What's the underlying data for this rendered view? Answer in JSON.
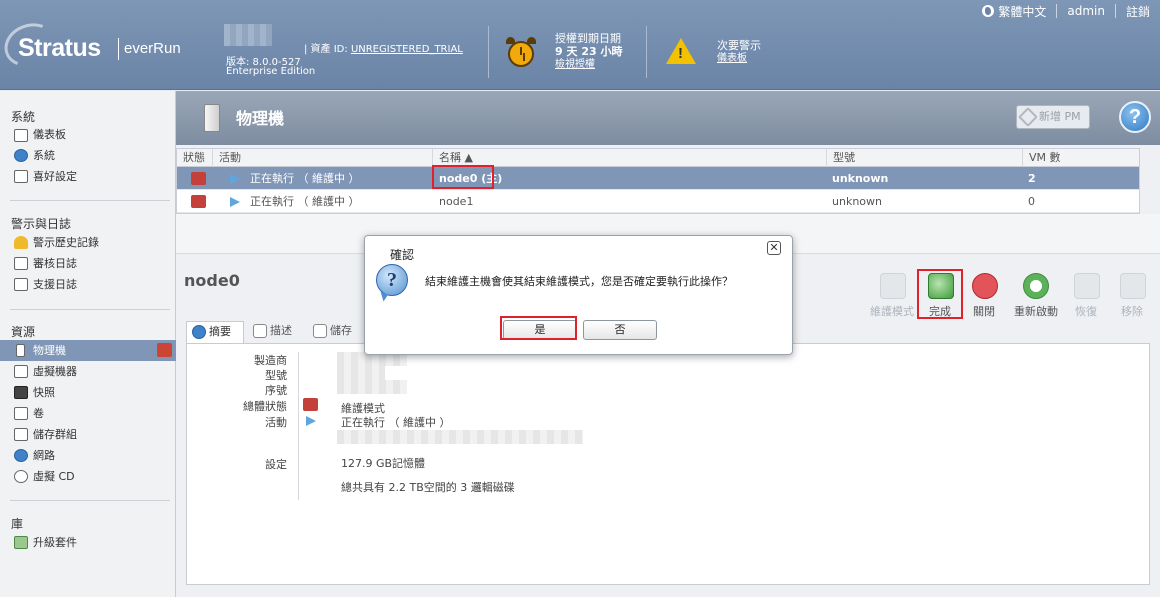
{
  "header": {
    "logo_brand": "Stratus",
    "logo_product": "everRun",
    "version_label": "版本: 8.0.0-527",
    "edition": "Enterprise Edition",
    "asset_label": "| 資產 ID:",
    "asset_value": "UNREGISTERED_TRIAL",
    "license_title": "授權到期日期",
    "license_remaining": "9 天 23 小時",
    "license_link": "檢視授權",
    "alert_title": "次要警示",
    "alert_link": "儀表板"
  },
  "topnav": {
    "language": "繁體中文",
    "user": "admin",
    "logout": "註銷"
  },
  "sidebar": {
    "system": {
      "title": "系統",
      "items": [
        {
          "label": "儀表板",
          "icon": "dashboard-icon"
        },
        {
          "label": "系統",
          "icon": "system-icon"
        },
        {
          "label": "喜好設定",
          "icon": "preferences-icon"
        }
      ]
    },
    "alerts": {
      "title": "警示與日誌",
      "items": [
        {
          "label": "警示歷史記錄",
          "icon": "alert-history-icon"
        },
        {
          "label": "審核日誌",
          "icon": "audit-log-icon"
        },
        {
          "label": "支援日誌",
          "icon": "support-log-icon"
        }
      ]
    },
    "resources": {
      "title": "資源",
      "items": [
        {
          "label": "物理機",
          "icon": "physical-machine-icon"
        },
        {
          "label": "虛擬機器",
          "icon": "virtual-machine-icon"
        },
        {
          "label": "快照",
          "icon": "snapshot-icon"
        },
        {
          "label": "卷",
          "icon": "volume-icon"
        },
        {
          "label": "儲存群組",
          "icon": "storage-group-icon"
        },
        {
          "label": "網路",
          "icon": "network-icon"
        },
        {
          "label": "虛擬 CD",
          "icon": "virtual-cd-icon"
        }
      ]
    },
    "library": {
      "title": "庫",
      "items": [
        {
          "label": "升級套件",
          "icon": "upgrade-kit-icon"
        }
      ]
    }
  },
  "main": {
    "title": "物理機",
    "add_pm": "新增 PM",
    "help": "?",
    "table": {
      "headers": [
        "狀態",
        "活動",
        "名稱 ▲",
        "型號",
        "VM 數"
      ],
      "rows": [
        {
          "activity": "正在執行 （ 維護中 ）",
          "name": "node0 (主)",
          "model": "unknown",
          "vms": "2"
        },
        {
          "activity": "正在執行 （ 維護中 ）",
          "name": "node1",
          "model": "unknown",
          "vms": "0"
        }
      ]
    },
    "detail": {
      "node": "node0",
      "actions": [
        "維護模式",
        "完成",
        "關閉",
        "重新啟動",
        "恢復",
        "移除"
      ],
      "tabs": [
        "摘要",
        "描述",
        "儲存"
      ],
      "labels": {
        "manufacturer": "製造商",
        "model": "型號",
        "serial": "序號",
        "overall_status": "總體狀態",
        "activity": "活動",
        "config": "設定"
      },
      "values": {
        "overall_status": "維護模式",
        "activity": "正在執行 （ 維護中 ）",
        "memory": "127.9 GB記憶體",
        "disks": "總共具有 2.2 TB空間的 3 邏輯磁碟"
      }
    }
  },
  "dialog": {
    "title": "確認",
    "message": "結束維護主機會使其結束維護模式，您是否確定要執行此操作？",
    "yes": "是",
    "no": "否",
    "close": "✕"
  }
}
